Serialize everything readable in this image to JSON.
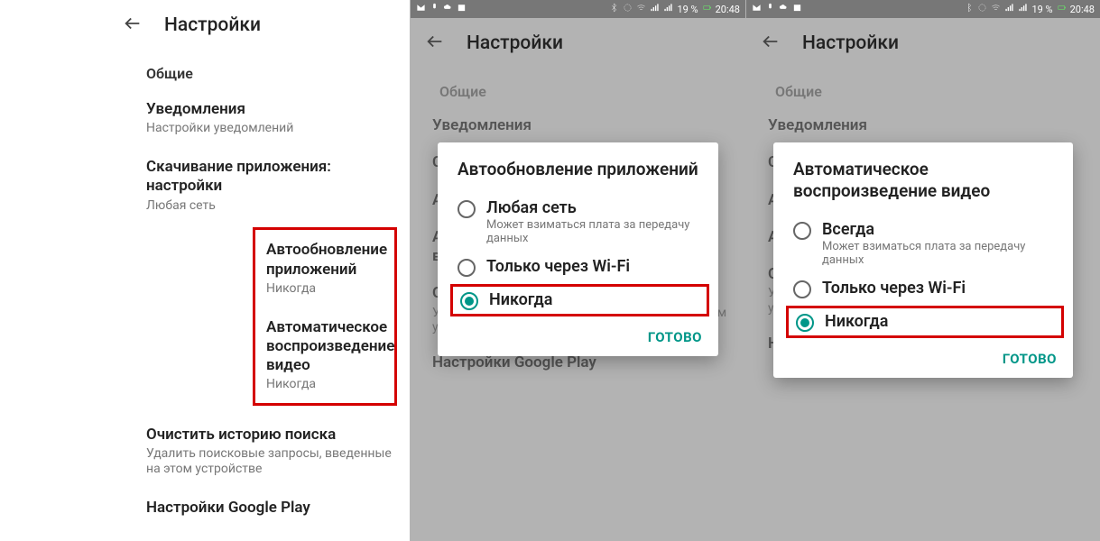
{
  "status": {
    "battery": "19 %",
    "time": "20:48"
  },
  "header": {
    "title": "Настройки"
  },
  "section": "Общие",
  "items": {
    "notifications": {
      "label": "Уведомления",
      "sub": "Настройки уведомлений"
    },
    "download": {
      "label": "Скачивание приложения: настройки",
      "sub": "Любая сеть"
    },
    "autoupdate": {
      "label": "Автообновление приложений",
      "sub": "Никогда"
    },
    "autoplay": {
      "label": "Автоматическое воспроизведение видео",
      "sub": "Никогда"
    },
    "clearhist": {
      "label": "Очистить историю поиска",
      "sub": "Удалить поисковые запросы, введенные на этом устройстве"
    },
    "gplay": {
      "label": "Настройки Google Play"
    }
  },
  "dialog1": {
    "title": "Автообновление приложений",
    "opt1": {
      "label": "Любая сеть",
      "sub": "Может взиматься плата за передачу данных"
    },
    "opt2": {
      "label": "Только через Wi-Fi"
    },
    "opt3": {
      "label": "Никогда"
    },
    "done": "ГОТОВО"
  },
  "dialog2": {
    "title": "Автоматическое воспроизведение видео",
    "opt1": {
      "label": "Всегда",
      "sub": "Может взиматься плата за передачу данных"
    },
    "opt2": {
      "label": "Только через Wi-Fi"
    },
    "opt3": {
      "label": "Никогда"
    },
    "done": "ГОТОВО"
  }
}
